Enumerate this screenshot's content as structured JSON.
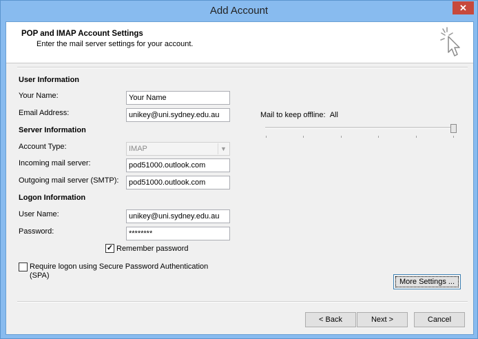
{
  "window": {
    "title": "Add Account",
    "close_label": "✕"
  },
  "header": {
    "title": "POP and IMAP Account Settings",
    "subtitle": "Enter the mail server settings for your account."
  },
  "user_info": {
    "heading": "User Information",
    "your_name_label": "Your Name:",
    "your_name_value": "Your Name",
    "email_label": "Email Address:",
    "email_value": "unikey@uni.sydney.edu.au"
  },
  "server_info": {
    "heading": "Server Information",
    "account_type_label": "Account Type:",
    "account_type_value": "IMAP",
    "incoming_label": "Incoming mail server:",
    "incoming_value": "pod51000.outlook.com",
    "outgoing_label": "Outgoing mail server (SMTP):",
    "outgoing_value": "pod51000.outlook.com"
  },
  "logon_info": {
    "heading": "Logon Information",
    "username_label": "User Name:",
    "username_value": "unikey@uni.sydney.edu.au",
    "password_label": "Password:",
    "password_value": "********",
    "remember_label": "Remember password",
    "remember_checked": true,
    "spa_label_line1": "Require logon using Secure Password Authentication",
    "spa_label_line2": "(SPA)",
    "spa_checked": false
  },
  "offline": {
    "label": "Mail to keep offline:",
    "value": "All",
    "slider_level": 1.0
  },
  "buttons": {
    "more_settings": "More Settings ...",
    "back": "< Back",
    "next": "Next >",
    "cancel": "Cancel"
  }
}
